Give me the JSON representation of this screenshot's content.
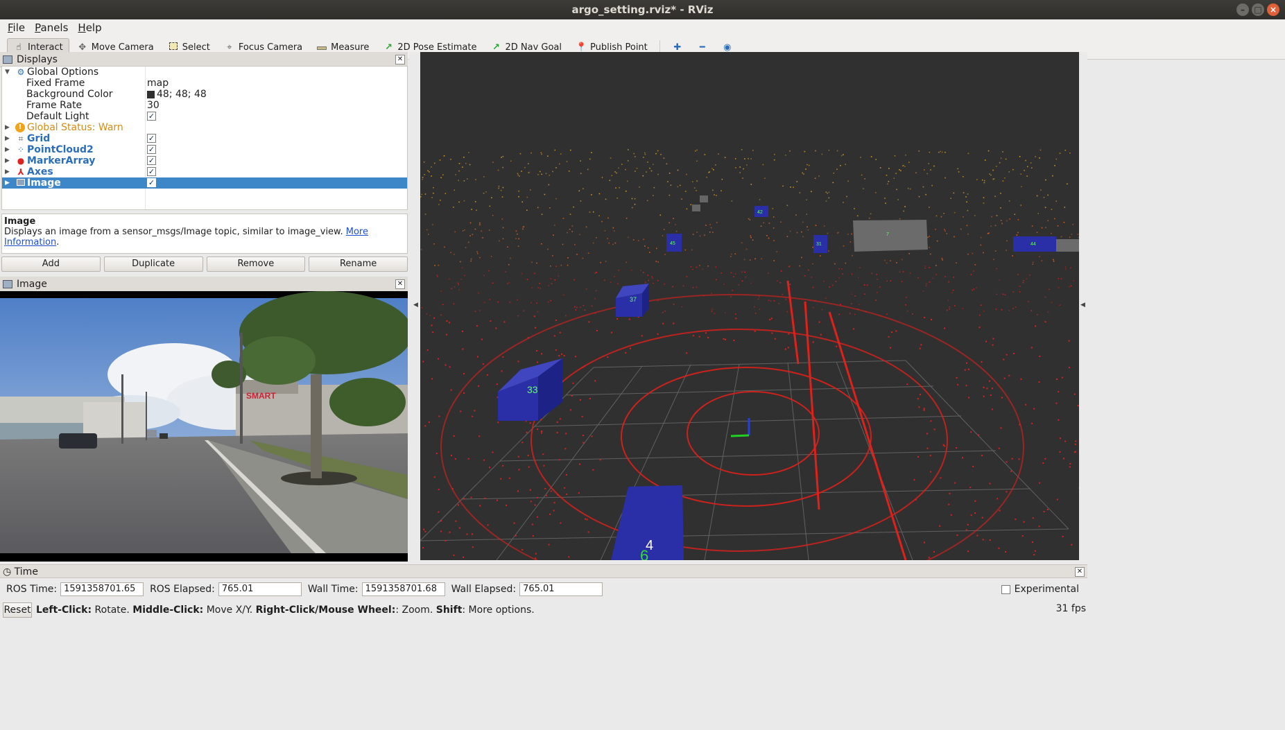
{
  "window": {
    "title": "argo_setting.rviz* - RViz",
    "buttons": [
      "minimize",
      "maximize",
      "close"
    ]
  },
  "menu": {
    "items": [
      {
        "label": "File",
        "u": "F",
        "rest": "ile"
      },
      {
        "label": "Panels",
        "u": "P",
        "rest": "anels"
      },
      {
        "label": "Help",
        "u": "H",
        "rest": "elp"
      }
    ]
  },
  "toolbar": {
    "tools": [
      {
        "label": "Interact",
        "icon": "hand-icon",
        "active": true
      },
      {
        "label": "Move Camera",
        "icon": "move-camera-icon"
      },
      {
        "label": "Select",
        "icon": "select-icon"
      },
      {
        "label": "Focus Camera",
        "icon": "focus-camera-icon"
      },
      {
        "label": "Measure",
        "icon": "ruler-icon"
      },
      {
        "label": "2D Pose Estimate",
        "icon": "green-arrow-icon"
      },
      {
        "label": "2D Nav Goal",
        "icon": "green-arrow-icon"
      },
      {
        "label": "Publish Point",
        "icon": "pin-icon"
      }
    ],
    "extra_icons": [
      "plus-icon",
      "minus-icon",
      "eye-icon"
    ]
  },
  "displays": {
    "title": "Displays",
    "global_options": {
      "label": "Global Options",
      "fixed_frame": {
        "label": "Fixed Frame",
        "value": "map"
      },
      "background_color": {
        "label": "Background Color",
        "value": "48; 48; 48",
        "swatch": "#303030"
      },
      "frame_rate": {
        "label": "Frame Rate",
        "value": "30"
      },
      "default_light": {
        "label": "Default Light",
        "checked": true
      }
    },
    "global_status": {
      "label": "Global Status: Warn"
    },
    "items": [
      {
        "label": "Grid",
        "checked": true
      },
      {
        "label": "PointCloud2",
        "checked": true
      },
      {
        "label": "MarkerArray",
        "checked": true
      },
      {
        "label": "Axes",
        "checked": true
      },
      {
        "label": "Image",
        "checked": true,
        "selected": true
      }
    ]
  },
  "description": {
    "title": "Image",
    "text": "Displays an image from a sensor_msgs/Image topic, similar to image_view. ",
    "link": "More Information",
    "suffix": "."
  },
  "buttons": {
    "add": "Add",
    "duplicate": "Duplicate",
    "remove": "Remove",
    "rename": "Rename"
  },
  "image_panel": {
    "title": "Image",
    "sign_text": "SMART"
  },
  "view3d": {
    "markers": [
      "4",
      "37",
      "33",
      "45",
      "31",
      "42",
      "7",
      "44",
      "4",
      "6"
    ]
  },
  "time_panel": {
    "title": "Time",
    "ros_time": {
      "label": "ROS Time:",
      "value": "1591358701.65"
    },
    "ros_elapsed": {
      "label": "ROS Elapsed:",
      "value": "765.01"
    },
    "wall_time": {
      "label": "Wall Time:",
      "value": "1591358701.68"
    },
    "wall_elapsed": {
      "label": "Wall Elapsed:",
      "value": "765.01"
    },
    "experimental": {
      "label": "Experimental",
      "checked": false
    }
  },
  "status": {
    "reset": "Reset",
    "parts": [
      {
        "b": "Left-Click:",
        "t": " Rotate. "
      },
      {
        "b": "Middle-Click:",
        "t": " Move X/Y. "
      },
      {
        "b": "Right-Click/Mouse Wheel:",
        "t": ": Zoom. "
      },
      {
        "b": "Shift",
        "t": ": More options."
      }
    ],
    "fps": "31 fps"
  },
  "colors": {
    "selection": "#3d87c9",
    "link_blue": "#2a6ebb",
    "warn": "#d68c0f",
    "view_bg": "#303030",
    "point_red": "#e0201a",
    "marker_blue": "#2a2fa8"
  }
}
